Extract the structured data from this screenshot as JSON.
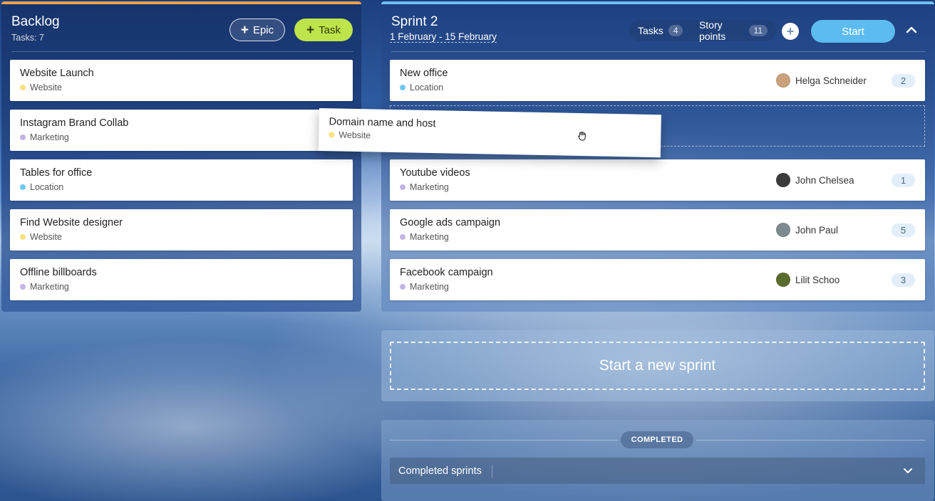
{
  "backlog": {
    "title": "Backlog",
    "subtitle": "Tasks: 7",
    "epic_button": "Epic",
    "task_button": "Task",
    "cards": [
      {
        "title": "Website Launch",
        "tag": "Website",
        "tag_color": "#f7e27d"
      },
      {
        "title": "Instagram Brand Collab",
        "tag": "Marketing",
        "tag_color": "#c3b4e6"
      },
      {
        "title": "Tables for office",
        "tag": "Location",
        "tag_color": "#6ec8f2"
      },
      {
        "title": "Find Website designer",
        "tag": "Website",
        "tag_color": "#f7e27d"
      },
      {
        "title": "Offline billboards",
        "tag": "Marketing",
        "tag_color": "#c3b4e6"
      }
    ]
  },
  "dragging_card": {
    "title": "Domain name and host",
    "tag": "Website",
    "tag_color": "#f7e27d"
  },
  "sprint": {
    "title": "Sprint 2",
    "dates": "1 February - 15 February",
    "tasks_label": "Tasks",
    "tasks_count": "4",
    "story_points_label": "Story points",
    "story_points_count": "11",
    "start_button": "Start",
    "cards": [
      {
        "title": "New office",
        "tag": "Location",
        "tag_color": "#6ec8f2",
        "assignee": "Helga Schneider",
        "avatar_color": "#c9a27c",
        "points": "2"
      },
      {
        "title": "Youtube videos",
        "tag": "Marketing",
        "tag_color": "#c3b4e6",
        "assignee": "John Chelsea",
        "avatar_color": "#3b3b3b",
        "points": "1"
      },
      {
        "title": "Google ads campaign",
        "tag": "Marketing",
        "tag_color": "#c3b4e6",
        "assignee": "John Paul",
        "avatar_color": "#7d8a8f",
        "points": "5"
      },
      {
        "title": "Facebook campaign",
        "tag": "Marketing",
        "tag_color": "#c3b4e6",
        "assignee": "Lilit Schoo",
        "avatar_color": "#5a6b2e",
        "points": "3"
      }
    ]
  },
  "new_sprint": {
    "label": "Start a new sprint"
  },
  "completed": {
    "label": "COMPLETED",
    "bar_label": "Completed sprints"
  },
  "colors": {
    "backlog_accent": "#f0a04b",
    "sprint_accent": "#6ec1f0",
    "task_button": "#bde44a",
    "start_button": "#5cbcf0"
  }
}
